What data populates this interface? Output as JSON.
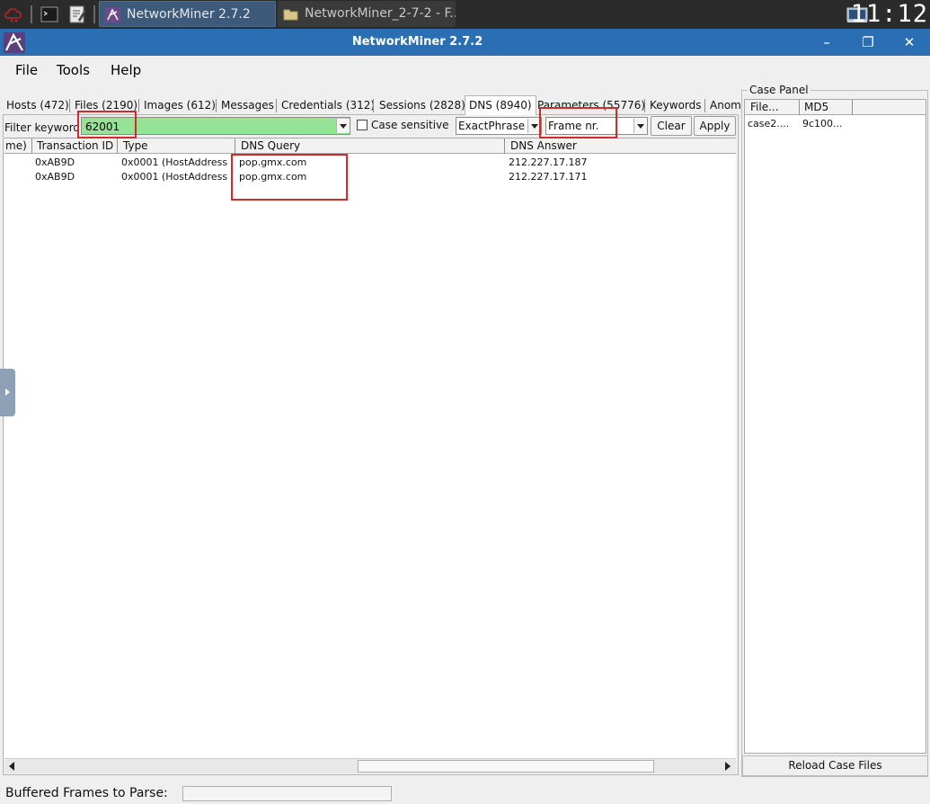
{
  "taskbar": {
    "tasks": [
      {
        "label": "NetworkMiner 2.7.2",
        "active": true
      },
      {
        "label": "NetworkMiner_2-7-2 - F...",
        "active": false
      }
    ],
    "clock": "11:12"
  },
  "window": {
    "title": "NetworkMiner 2.7.2",
    "controls": {
      "minimize": "–",
      "maximize": "❐",
      "close": "✕"
    }
  },
  "menu": {
    "items": [
      "File",
      "Tools",
      "Help"
    ]
  },
  "tabs": [
    {
      "label": "Hosts (472)"
    },
    {
      "label": "Files (2190)"
    },
    {
      "label": "Images (612)"
    },
    {
      "label": "Messages"
    },
    {
      "label": "Credentials (312)"
    },
    {
      "label": "Sessions (2828)"
    },
    {
      "label": "DNS (8940)",
      "active": true
    },
    {
      "label": "Parameters (55776)"
    },
    {
      "label": "Keywords"
    },
    {
      "label": "Anom"
    }
  ],
  "filter": {
    "label": "Filter keyword",
    "value": "62001",
    "case_sensitive_label": "Case sensitive",
    "case_sensitive_checked": false,
    "match_mode": "ExactPhrase",
    "column": "Frame nr.",
    "clear_label": "Clear",
    "apply_label": "Apply"
  },
  "dns_table": {
    "columns": [
      "me)",
      "Transaction ID",
      "Type",
      "DNS Query",
      "DNS Answer"
    ],
    "rows": [
      {
        "time": "",
        "transaction_id": "0xAB9D",
        "type": "0x0001 (HostAddress",
        "query": "pop.gmx.com",
        "answer": "212.227.17.187"
      },
      {
        "time": "",
        "transaction_id": "0xAB9D",
        "type": "0x0001 (HostAddress",
        "query": "pop.gmx.com",
        "answer": "212.227.17.171"
      }
    ]
  },
  "case_panel": {
    "title": "Case Panel",
    "columns": [
      "File...",
      "MD5"
    ],
    "rows": [
      {
        "file": "case2....",
        "md5": "9c100..."
      }
    ],
    "reload_label": "Reload Case Files"
  },
  "status": {
    "label": "Buffered Frames to Parse:",
    "progress": 0
  },
  "colors": {
    "titlebar": "#2a6fb3",
    "filter_match": "#95e495",
    "highlight": "#d42a2a"
  }
}
